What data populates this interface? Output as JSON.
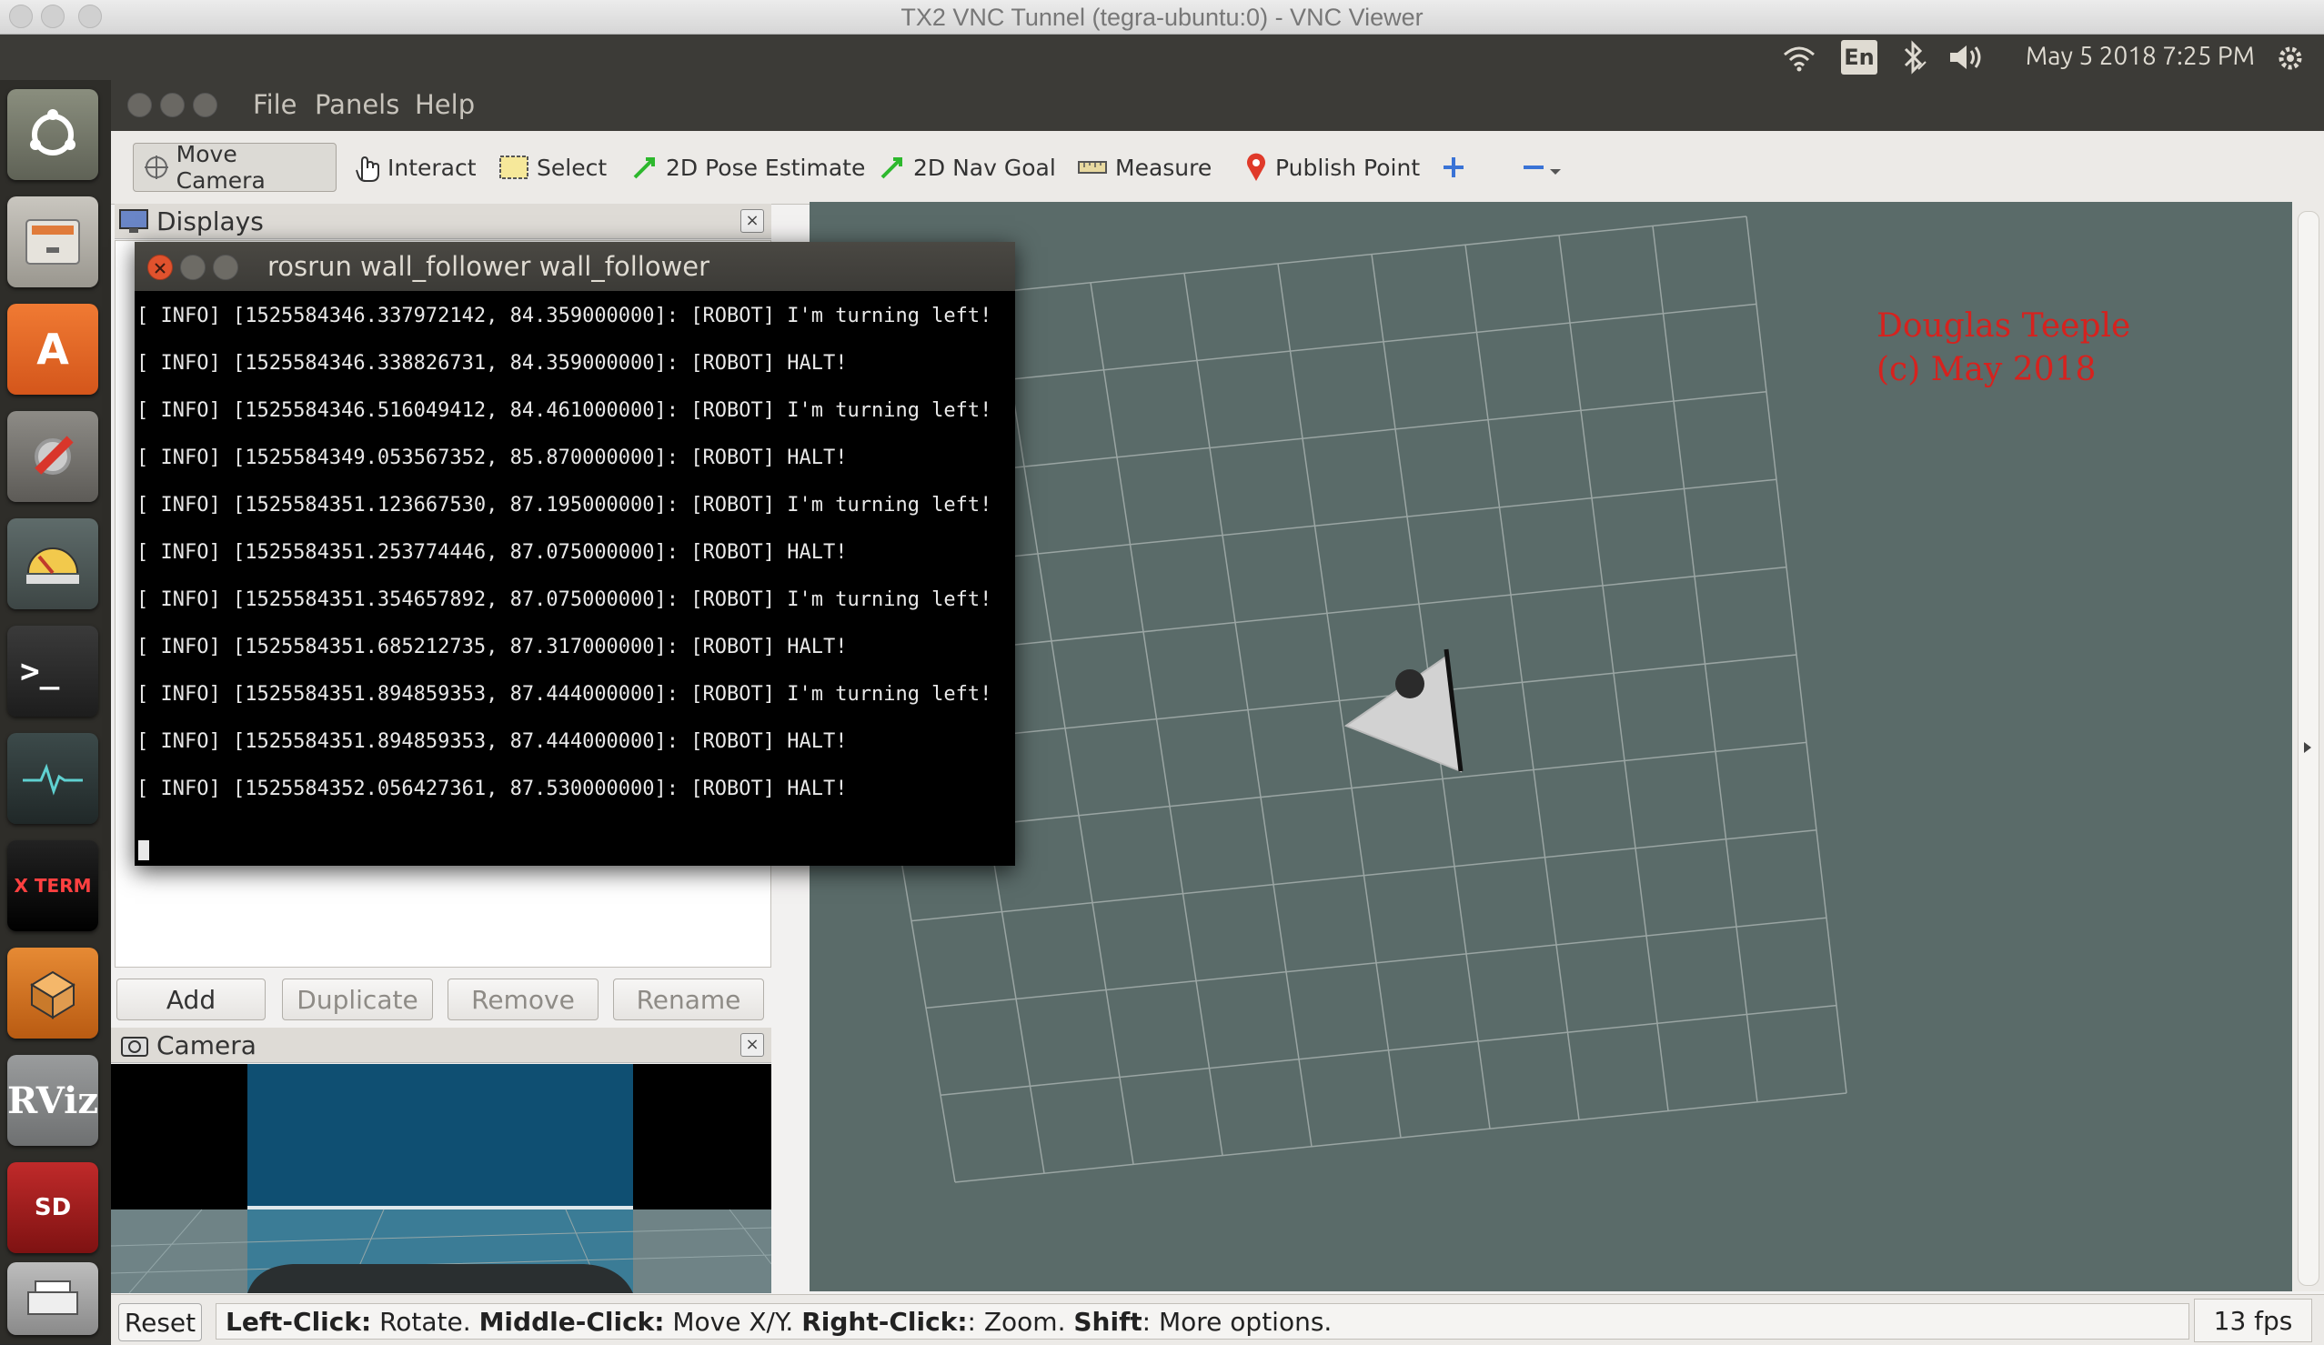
{
  "mac": {
    "title": "TX2 VNC Tunnel (tegra-ubuntu:0) - VNC Viewer"
  },
  "panel": {
    "lang": "En",
    "clock": "May 5 2018  7:25 PM"
  },
  "launcher": {
    "items": [
      {
        "name": "ubuntu-dash"
      },
      {
        "name": "files"
      },
      {
        "name": "software-center",
        "glyph": "A"
      },
      {
        "name": "system-settings"
      },
      {
        "name": "disk-usage"
      },
      {
        "name": "terminal",
        "glyph": ">_"
      },
      {
        "name": "system-monitor"
      },
      {
        "name": "xterm",
        "glyph": "X TERM"
      },
      {
        "name": "3d-package"
      },
      {
        "name": "rviz",
        "glyph": "RViz"
      },
      {
        "name": "sd-card",
        "glyph": "SD"
      },
      {
        "name": "scanner"
      }
    ]
  },
  "rviz": {
    "menu": [
      "File",
      "Panels",
      "Help"
    ],
    "tools": [
      "Move Camera",
      "Interact",
      "Select",
      "2D Pose Estimate",
      "2D Nav Goal",
      "Measure",
      "Publish Point"
    ],
    "displays_title": "Displays",
    "buttons": [
      "Add",
      "Duplicate",
      "Remove",
      "Rename"
    ],
    "camera_title": "Camera",
    "status": {
      "reset": "Reset",
      "hint_parts": [
        {
          "b": "Left-Click:",
          "t": " Rotate. "
        },
        {
          "b": "Middle-Click:",
          "t": " Move X/Y. "
        },
        {
          "b": "Right-Click:",
          "t": ": Zoom. "
        },
        {
          "b": "Shift",
          "t": ": More options."
        }
      ],
      "fps": "13 fps"
    },
    "watermark": [
      "Douglas Teeple",
      "(c) May 2018"
    ]
  },
  "terminal": {
    "title": "rosrun wall_follower wall_follower",
    "lines": [
      "[ INFO] [1525584346.337972142, 84.359000000]: [ROBOT] I'm turning left!",
      "[ INFO] [1525584346.338826731, 84.359000000]: [ROBOT] HALT!",
      "[ INFO] [1525584346.516049412, 84.461000000]: [ROBOT] I'm turning left!",
      "[ INFO] [1525584349.053567352, 85.870000000]: [ROBOT] HALT!",
      "[ INFO] [1525584351.123667530, 87.195000000]: [ROBOT] I'm turning left!",
      "[ INFO] [1525584351.253774446, 87.075000000]: [ROBOT] HALT!",
      "[ INFO] [1525584351.354657892, 87.075000000]: [ROBOT] I'm turning left!",
      "[ INFO] [1525584351.685212735, 87.317000000]: [ROBOT] HALT!",
      "[ INFO] [1525584351.894859353, 87.444000000]: [ROBOT] I'm turning left!",
      "[ INFO] [1525584351.894859353, 87.444000000]: [ROBOT] HALT!",
      "[ INFO] [1525584352.056427361, 87.530000000]: [ROBOT] HALT!"
    ]
  },
  "colors": {
    "view_bg": "#5a6b69",
    "grid": "#9aa5a3",
    "watermark": "#d6221e",
    "terminal_bg": "#000000"
  }
}
